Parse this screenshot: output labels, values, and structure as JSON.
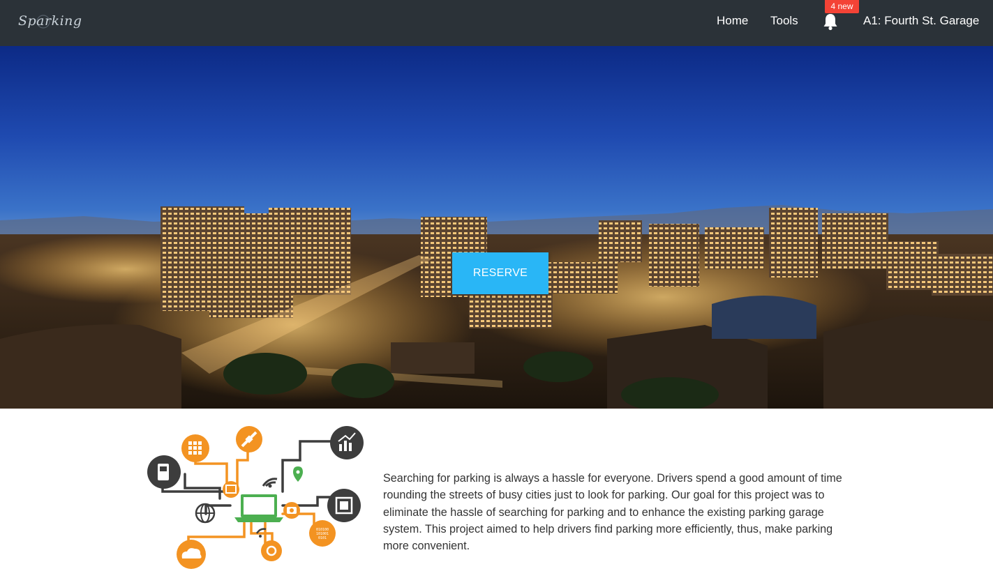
{
  "navbar": {
    "logo_text": "Sparking",
    "links": [
      {
        "label": "Home"
      },
      {
        "label": "Tools"
      }
    ],
    "notifications": {
      "badge": "4 new",
      "icon": "bell-icon"
    },
    "garage_label": "A1: Fourth St. Garage"
  },
  "hero": {
    "reserve_label": "RESERVE"
  },
  "about": {
    "text": "Searching for parking is always a hassle for everyone. Drivers spend a good amount of time rounding the streets of busy cities just to look for parking. Our goal for this project was to eliminate the hassle of searching for parking and to enhance the existing parking garage system. This project aimed to help drivers find parking more efficiently, thus, make parking more convenient."
  },
  "colors": {
    "navbar_bg": "#2b3238",
    "accent": "#29b6f6",
    "badge": "#f44336",
    "illustration_orange": "#f39322",
    "illustration_dark": "#3d3d3d",
    "illustration_green": "#4caf50"
  }
}
